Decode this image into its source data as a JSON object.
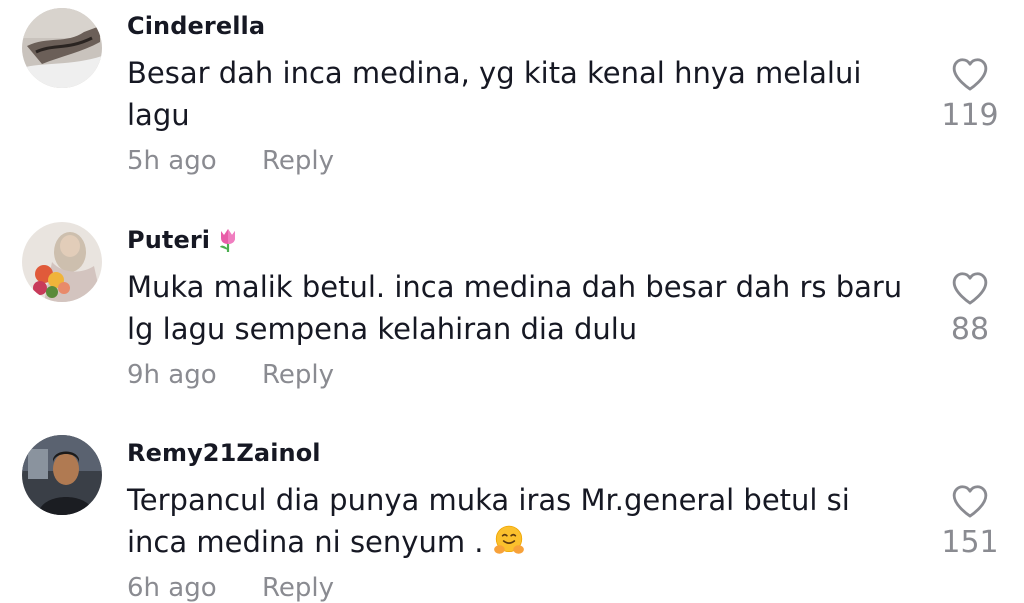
{
  "comments": [
    {
      "username": "Cinderella",
      "text": "Besar dah inca medina, yg kita kenal hnya melalui lagu",
      "time": "5h ago",
      "reply_label": "Reply",
      "likes": "119"
    },
    {
      "username": "Puteri",
      "username_emoji": "tulip-icon",
      "text": "Muka malik betul. inca medina dah besar dah rs baru lg lagu sempena kelahiran dia dulu",
      "time": "9h ago",
      "reply_label": "Reply",
      "likes": "88"
    },
    {
      "username": "Remy21Zainol",
      "text": "Terpancul dia punya muka iras Mr.general betul si inca medina ni senyum .",
      "text_emoji": "hugging-face-emoji",
      "time": "6h ago",
      "reply_label": "Reply",
      "likes": "151"
    }
  ],
  "icons": {
    "like": "heart-outline-icon"
  },
  "colors": {
    "primary_text": "#161823",
    "secondary_text": "#8a8b91",
    "background": "#ffffff"
  }
}
